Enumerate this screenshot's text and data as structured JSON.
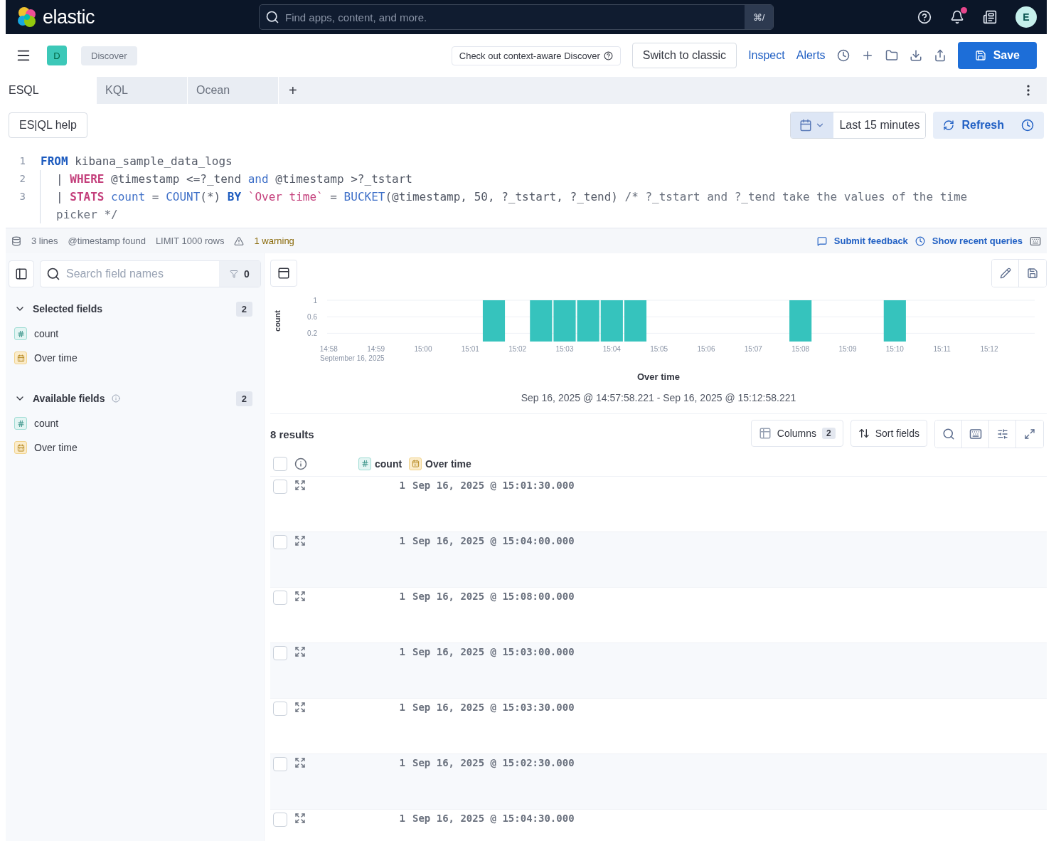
{
  "header": {
    "logo_text": "elastic",
    "search": {
      "placeholder": "Find apps, content, and more.",
      "shortcut": "⌘/"
    },
    "avatar": "E",
    "notification_dot": true
  },
  "toolbar": {
    "app_badge": "D",
    "breadcrumb": "Discover",
    "promo": "Check out context-aware Discover",
    "switch_button": "Switch to classic",
    "links": [
      "Inspect",
      "Alerts"
    ],
    "save_button": "Save"
  },
  "tabs": [
    {
      "label": "ESQL",
      "selected": true
    },
    {
      "label": "KQL",
      "selected": false
    },
    {
      "label": "Ocean",
      "selected": false
    }
  ],
  "add_tab": "+",
  "query_bar": {
    "help_button": "ES|QL help",
    "time_range": "Last 15 minutes",
    "refresh_button": "Refresh"
  },
  "editor": {
    "lines": [
      {
        "number": "1",
        "indent": false,
        "tokens": [
          {
            "kind": "keyword",
            "text": "FROM"
          },
          {
            "kind": "plain",
            "text": " kibana_sample_data_logs"
          }
        ]
      },
      {
        "number": "2",
        "indent": true,
        "tokens": [
          {
            "kind": "plain",
            "text": "| "
          },
          {
            "kind": "command",
            "text": "WHERE"
          },
          {
            "kind": "plain",
            "text": " @timestamp <=?_tend "
          },
          {
            "kind": "function",
            "text": "and"
          },
          {
            "kind": "plain",
            "text": " @timestamp >?_tstart"
          }
        ]
      },
      {
        "number": "3",
        "indent": true,
        "tokens": [
          {
            "kind": "plain",
            "text": "| "
          },
          {
            "kind": "command",
            "text": "STATS"
          },
          {
            "kind": "function",
            "text": " count"
          },
          {
            "kind": "plain",
            "text": " = "
          },
          {
            "kind": "function",
            "text": "COUNT"
          },
          {
            "kind": "plain",
            "text": "(*) "
          },
          {
            "kind": "keyword",
            "text": "BY"
          },
          {
            "kind": "string",
            "text": " `Over time`"
          },
          {
            "kind": "plain",
            "text": " = "
          },
          {
            "kind": "function",
            "text": "BUCKET"
          },
          {
            "kind": "plain",
            "text": "(@timestamp, 50, ?_tstart, ?_tend) "
          },
          {
            "kind": "comment",
            "text": "/* ?_tstart and ?_tend take the values of the time picker */"
          }
        ]
      }
    ]
  },
  "status": {
    "items": [
      "3 lines",
      "@timestamp found",
      "LIMIT 1000 rows"
    ],
    "warning": "1 warning",
    "links": [
      "Submit feedback",
      "Show recent queries"
    ]
  },
  "sidebar": {
    "search": {
      "placeholder": "Search field names"
    },
    "filter_count": "0",
    "sections": [
      {
        "title": "Selected fields",
        "info": false,
        "count": "2",
        "expanded": true,
        "fields": [
          {
            "name": "count",
            "kind": "number"
          },
          {
            "name": "Over time",
            "kind": "date"
          }
        ]
      },
      {
        "title": "Available fields",
        "info": true,
        "count": "2",
        "expanded": true,
        "fields": [
          {
            "name": "count",
            "kind": "number"
          },
          {
            "name": "Over time",
            "kind": "date"
          }
        ]
      }
    ]
  },
  "chart": {
    "time_range": "Sep 16, 2025 @ 14:57:58.221 - Sep 16, 2025 @ 15:12:58.221",
    "date_label": "September 16, 2025",
    "chart_data": {
      "type": "bar",
      "xlabel": "Over time",
      "ylabel": "count",
      "categories": [
        "14:58",
        null,
        "14:59",
        null,
        "15:00",
        null,
        "15:01",
        null,
        "15:02",
        null,
        "15:03",
        null,
        "15:04",
        null,
        "15:05",
        null,
        "15:06",
        null,
        "15:07",
        null,
        "15:08",
        null,
        "15:09",
        null,
        "15:10",
        null,
        "15:11",
        null,
        "15:12",
        null
      ],
      "values": [
        null,
        null,
        null,
        null,
        null,
        null,
        null,
        1,
        null,
        1,
        1,
        1,
        1,
        1,
        null,
        null,
        null,
        null,
        null,
        null,
        1,
        null,
        null,
        null,
        1,
        null,
        null,
        null,
        null,
        null
      ],
      "ylim": [
        0,
        1
      ],
      "yticks": [
        0.2,
        0.6,
        1
      ]
    }
  },
  "results": {
    "count_label": "8 results",
    "columns_button": "Columns",
    "columns_count": "2",
    "sort_button": "Sort fields",
    "header_checked": false,
    "columns": [
      {
        "name": "count",
        "kind": "number"
      },
      {
        "name": "Over time",
        "kind": "date"
      }
    ],
    "rows": [
      {
        "checked": false,
        "count": "1",
        "time": "Sep 16, 2025 @ 15:01:30.000"
      },
      {
        "checked": false,
        "count": "1",
        "time": "Sep 16, 2025 @ 15:04:00.000"
      },
      {
        "checked": false,
        "count": "1",
        "time": "Sep 16, 2025 @ 15:08:00.000"
      },
      {
        "checked": false,
        "count": "1",
        "time": "Sep 16, 2025 @ 15:03:00.000"
      },
      {
        "checked": false,
        "count": "1",
        "time": "Sep 16, 2025 @ 15:03:30.000"
      },
      {
        "checked": false,
        "count": "1",
        "time": "Sep 16, 2025 @ 15:02:30.000"
      },
      {
        "checked": false,
        "count": "1",
        "time": "Sep 16, 2025 @ 15:04:30.000"
      }
    ]
  }
}
